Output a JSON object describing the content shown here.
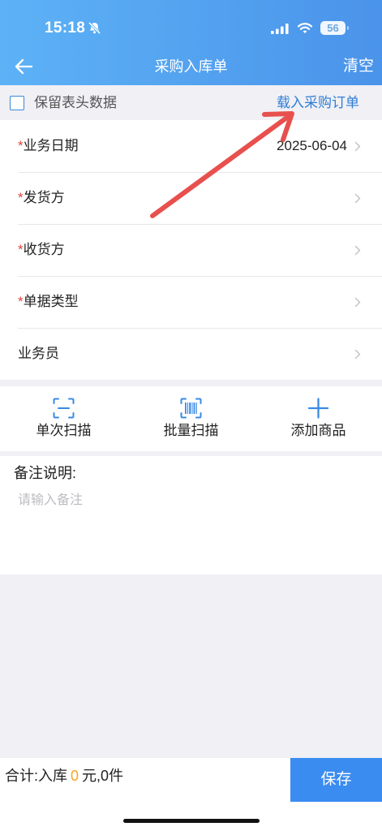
{
  "status_bar": {
    "time": "15:18",
    "battery": "56",
    "icons": [
      "bell-slash-icon",
      "signal-icon",
      "wifi-icon",
      "battery-icon"
    ]
  },
  "nav": {
    "title": "采购入库单",
    "clear_label": "清空",
    "back_icon": "back-arrow-icon"
  },
  "options": {
    "keep_header_label": "保留表头数据",
    "keep_header_checked": false,
    "load_order_label": "载入采购订单"
  },
  "form": {
    "required_mark": "*",
    "fields": [
      {
        "label": "业务日期",
        "required": true,
        "value": "2025-06-04"
      },
      {
        "label": "发货方",
        "required": true,
        "value": ""
      },
      {
        "label": "收货方",
        "required": true,
        "value": ""
      },
      {
        "label": "单据类型",
        "required": true,
        "value": ""
      },
      {
        "label": "业务员",
        "required": false,
        "value": ""
      }
    ]
  },
  "actions": [
    {
      "label": "单次扫描",
      "icon": "scan-icon"
    },
    {
      "label": "批量扫描",
      "icon": "barcode-scan-icon"
    },
    {
      "label": "添加商品",
      "icon": "plus-icon"
    }
  ],
  "remarks": {
    "label": "备注说明:",
    "placeholder": "请输入备注",
    "value": ""
  },
  "footer": {
    "total_label": "合计:入库",
    "amount": "0",
    "amount_unit": "元,",
    "count": "0",
    "count_unit": "件",
    "save_label": "保存"
  },
  "colors": {
    "header_gradient_start": "#5db2f6",
    "header_gradient_end": "#4a93ea",
    "accent": "#3b8cf0",
    "link": "#2f7dd5",
    "icon": "#3a8ae6",
    "required": "#e3413b",
    "amount_highlight": "#f5a623",
    "annotation_arrow": "#e8504e",
    "page_background": "#f0f0f5"
  }
}
